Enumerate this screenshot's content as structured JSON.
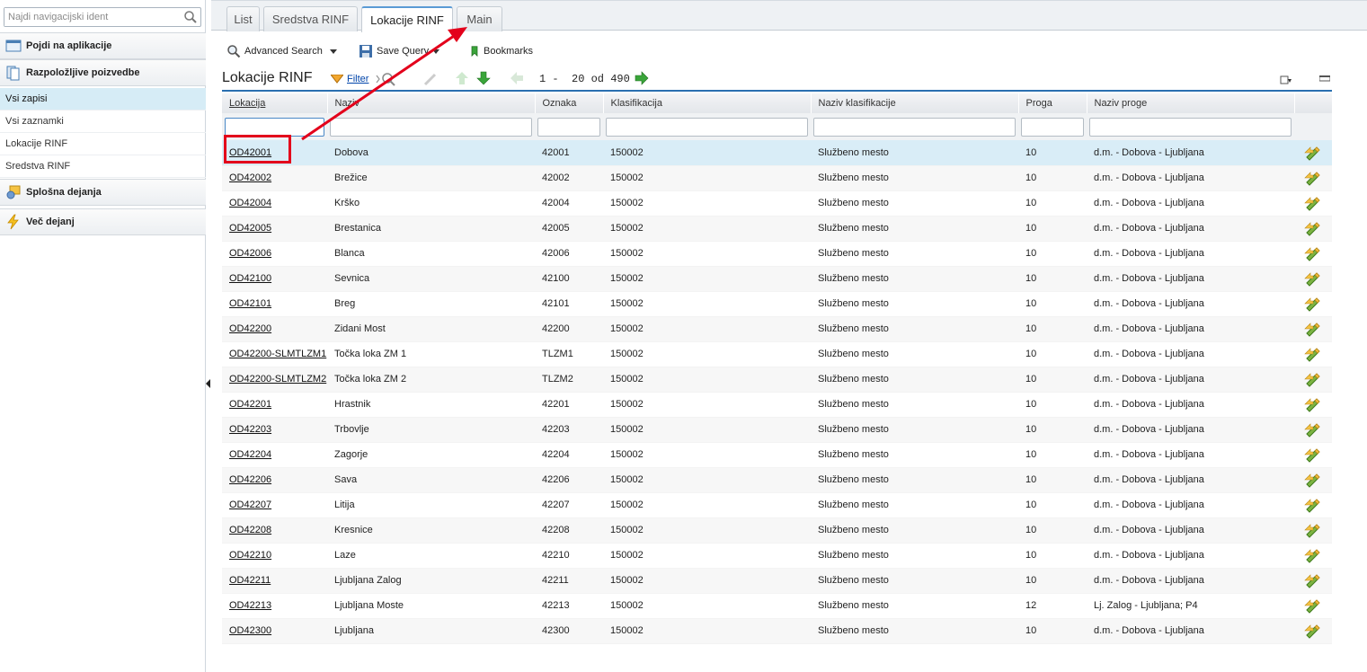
{
  "sidebar": {
    "search_placeholder": "Najdi navigacijski ident",
    "sections": [
      {
        "label": "Pojdi na aplikacije",
        "icon": "application-icon"
      },
      {
        "label": "Razpoložljive poizvedbe",
        "icon": "query-icon"
      },
      {
        "label": "Splošna dejanja",
        "icon": "actions-icon"
      },
      {
        "label": "Več dejanj",
        "icon": "lightning-icon"
      }
    ],
    "items": [
      {
        "label": "Vsi zapisi"
      },
      {
        "label": "Vsi zaznamki"
      },
      {
        "label": "Lokacije RINF"
      },
      {
        "label": "Sredstva RINF"
      }
    ]
  },
  "tabs": [
    {
      "label": "List"
    },
    {
      "label": "Sredstva RINF"
    },
    {
      "label": "Lokacije RINF"
    },
    {
      "label": "Main"
    }
  ],
  "toolbar": {
    "advanced_search": "Advanced Search",
    "save_query": "Save Query",
    "bookmarks": "Bookmarks"
  },
  "header": {
    "title": "Lokacije RINF",
    "filter": "Filter",
    "pager": "1 -  20 od 490"
  },
  "columns": [
    "Lokacija",
    "Naziv",
    "Oznaka",
    "Klasifikacija",
    "Naziv klasifikacije",
    "Proga",
    "Naziv proge"
  ],
  "rows": [
    {
      "lok": "OD42001",
      "naziv": "Dobova",
      "oznaka": "42001",
      "klas": "150002",
      "nazklas": "Službeno mesto",
      "proga": "10",
      "nazproge": "d.m. - Dobova - Ljubljana"
    },
    {
      "lok": "OD42002",
      "naziv": "Brežice",
      "oznaka": "42002",
      "klas": "150002",
      "nazklas": "Službeno mesto",
      "proga": "10",
      "nazproge": "d.m. - Dobova - Ljubljana"
    },
    {
      "lok": "OD42004",
      "naziv": "Krško",
      "oznaka": "42004",
      "klas": "150002",
      "nazklas": "Službeno mesto",
      "proga": "10",
      "nazproge": "d.m. - Dobova - Ljubljana"
    },
    {
      "lok": "OD42005",
      "naziv": "Brestanica",
      "oznaka": "42005",
      "klas": "150002",
      "nazklas": "Službeno mesto",
      "proga": "10",
      "nazproge": "d.m. - Dobova - Ljubljana"
    },
    {
      "lok": "OD42006",
      "naziv": "Blanca",
      "oznaka": "42006",
      "klas": "150002",
      "nazklas": "Službeno mesto",
      "proga": "10",
      "nazproge": "d.m. - Dobova - Ljubljana"
    },
    {
      "lok": "OD42100",
      "naziv": "Sevnica",
      "oznaka": "42100",
      "klas": "150002",
      "nazklas": "Službeno mesto",
      "proga": "10",
      "nazproge": "d.m. - Dobova - Ljubljana"
    },
    {
      "lok": "OD42101",
      "naziv": "Breg",
      "oznaka": "42101",
      "klas": "150002",
      "nazklas": "Službeno mesto",
      "proga": "10",
      "nazproge": "d.m. - Dobova - Ljubljana"
    },
    {
      "lok": "OD42200",
      "naziv": "Zidani Most",
      "oznaka": "42200",
      "klas": "150002",
      "nazklas": "Službeno mesto",
      "proga": "10",
      "nazproge": "d.m. - Dobova - Ljubljana"
    },
    {
      "lok": "OD42200-SLMTLZM1",
      "naziv": "Točka loka ZM 1",
      "oznaka": "TLZM1",
      "klas": "150002",
      "nazklas": "Službeno mesto",
      "proga": "10",
      "nazproge": "d.m. - Dobova - Ljubljana"
    },
    {
      "lok": "OD42200-SLMTLZM2",
      "naziv": "Točka loka ZM 2",
      "oznaka": "TLZM2",
      "klas": "150002",
      "nazklas": "Službeno mesto",
      "proga": "10",
      "nazproge": "d.m. - Dobova - Ljubljana"
    },
    {
      "lok": "OD42201",
      "naziv": "Hrastnik",
      "oznaka": "42201",
      "klas": "150002",
      "nazklas": "Službeno mesto",
      "proga": "10",
      "nazproge": "d.m. - Dobova - Ljubljana"
    },
    {
      "lok": "OD42203",
      "naziv": "Trbovlje",
      "oznaka": "42203",
      "klas": "150002",
      "nazklas": "Službeno mesto",
      "proga": "10",
      "nazproge": "d.m. - Dobova - Ljubljana"
    },
    {
      "lok": "OD42204",
      "naziv": "Zagorje",
      "oznaka": "42204",
      "klas": "150002",
      "nazklas": "Službeno mesto",
      "proga": "10",
      "nazproge": "d.m. - Dobova - Ljubljana"
    },
    {
      "lok": "OD42206",
      "naziv": "Sava",
      "oznaka": "42206",
      "klas": "150002",
      "nazklas": "Službeno mesto",
      "proga": "10",
      "nazproge": "d.m. - Dobova - Ljubljana"
    },
    {
      "lok": "OD42207",
      "naziv": "Litija",
      "oznaka": "42207",
      "klas": "150002",
      "nazklas": "Službeno mesto",
      "proga": "10",
      "nazproge": "d.m. - Dobova - Ljubljana"
    },
    {
      "lok": "OD42208",
      "naziv": "Kresnice",
      "oznaka": "42208",
      "klas": "150002",
      "nazklas": "Službeno mesto",
      "proga": "10",
      "nazproge": "d.m. - Dobova - Ljubljana"
    },
    {
      "lok": "OD42210",
      "naziv": "Laze",
      "oznaka": "42210",
      "klas": "150002",
      "nazklas": "Službeno mesto",
      "proga": "10",
      "nazproge": "d.m. - Dobova - Ljubljana"
    },
    {
      "lok": "OD42211",
      "naziv": "Ljubljana Zalog",
      "oznaka": "42211",
      "klas": "150002",
      "nazklas": "Službeno mesto",
      "proga": "10",
      "nazproge": "d.m. - Dobova - Ljubljana"
    },
    {
      "lok": "OD42213",
      "naziv": "Ljubljana Moste",
      "oznaka": "42213",
      "klas": "150002",
      "nazklas": "Službeno mesto",
      "proga": "12",
      "nazproge": "Lj. Zalog - Ljubljana; P4"
    },
    {
      "lok": "OD42300",
      "naziv": "Ljubljana",
      "oznaka": "42300",
      "klas": "150002",
      "nazklas": "Službeno mesto",
      "proga": "10",
      "nazproge": "d.m. - Dobova - Ljubljana"
    }
  ],
  "colors": {
    "accent": "#2a6fb0",
    "highlight_row": "#d9edf7",
    "annotation": "#e3001b"
  }
}
